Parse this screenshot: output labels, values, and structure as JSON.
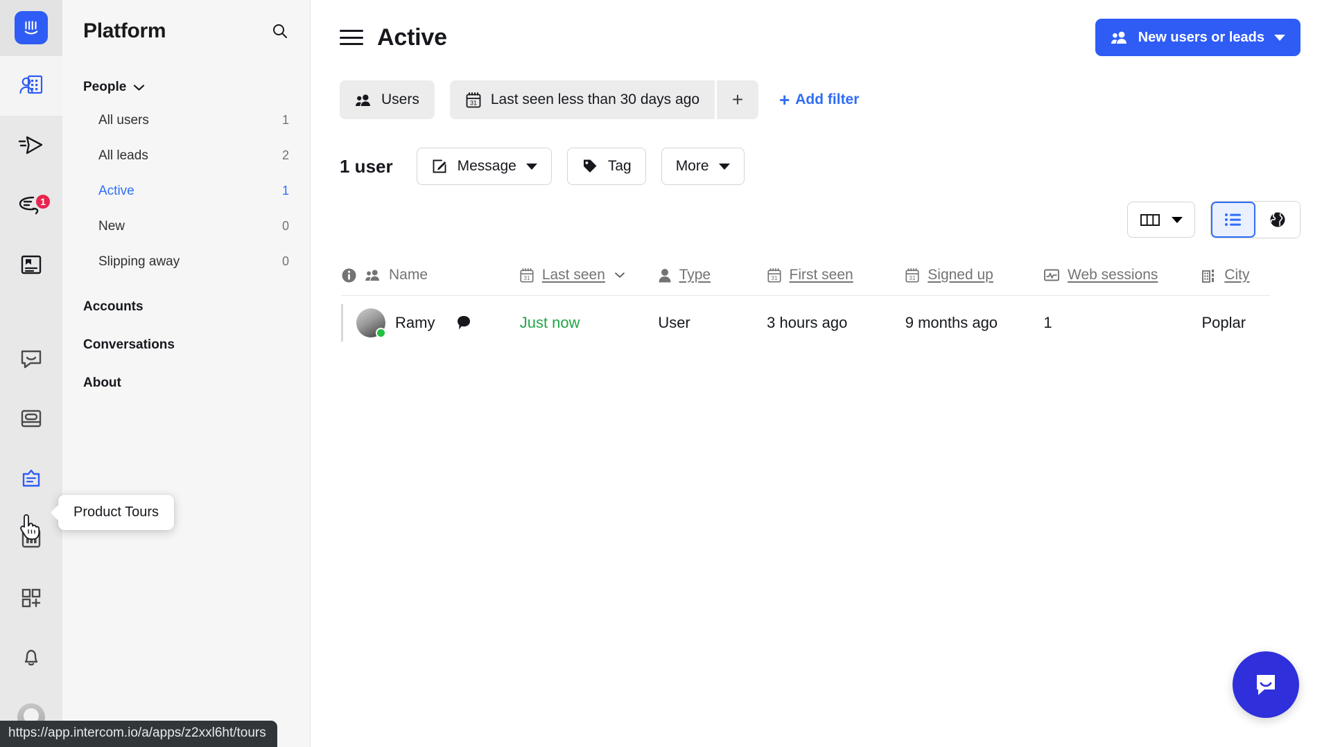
{
  "rail": {
    "logo_name": "intercom-logo",
    "items": [
      {
        "name": "contacts-icon",
        "badge": null,
        "active": true
      },
      {
        "name": "outbound-send-icon",
        "badge": null,
        "active": false
      },
      {
        "name": "conversations-reply-icon",
        "badge": "1",
        "active": false
      },
      {
        "name": "articles-icon",
        "badge": null,
        "active": false
      },
      {
        "name": "messenger-chat-icon",
        "badge": null,
        "active": false
      },
      {
        "name": "banners-icon",
        "badge": null,
        "active": false
      },
      {
        "name": "product-tours-icon",
        "badge": null,
        "active": false
      },
      {
        "name": "reports-chart-icon",
        "badge": null,
        "active": false
      },
      {
        "name": "app-store-icon",
        "badge": null,
        "active": false
      },
      {
        "name": "notifications-bell-icon",
        "badge": null,
        "active": false
      }
    ],
    "tooltip": "Product Tours"
  },
  "sidebar": {
    "title": "Platform",
    "search_icon": "search-icon",
    "group": {
      "label": "People",
      "chevron": "chevron-down-icon",
      "items": [
        {
          "label": "All users",
          "count": "1",
          "selected": false
        },
        {
          "label": "All leads",
          "count": "2",
          "selected": false
        },
        {
          "label": "Active",
          "count": "1",
          "selected": true
        },
        {
          "label": "New",
          "count": "0",
          "selected": false
        },
        {
          "label": "Slipping away",
          "count": "0",
          "selected": false
        }
      ]
    },
    "top_links": [
      "Accounts",
      "Conversations",
      "About"
    ]
  },
  "header": {
    "menu_icon": "hamburger-menu-icon",
    "title": "Active",
    "primary_button": {
      "label": "New users or leads",
      "icon": "users-icon",
      "caret": "chevron-down-icon",
      "color": "#2f5cf5"
    }
  },
  "filters": {
    "audience_chip": {
      "label": "Users",
      "icon": "users-icon"
    },
    "filter_chip": {
      "label": "Last seen less than 30 days ago",
      "icon": "calendar-icon"
    },
    "chip_plus": "+",
    "add_filter": "Add filter",
    "add_filter_plus": "+"
  },
  "actions": {
    "count_label": "1 user",
    "buttons": [
      {
        "label": "Message",
        "icon": "compose-icon",
        "caret": true
      },
      {
        "label": "Tag",
        "icon": "tag-icon",
        "caret": false
      },
      {
        "label": "More",
        "icon": null,
        "caret": true
      }
    ]
  },
  "view_controls": {
    "columns_button": {
      "icon": "columns-icon",
      "caret": "chevron-down-icon"
    },
    "list_view": {
      "icon": "list-view-icon",
      "active": true
    },
    "map_view": {
      "icon": "globe-icon",
      "active": false
    },
    "accent": "#2f6df6"
  },
  "table": {
    "columns": [
      {
        "key": "name",
        "label": "Name",
        "icon": "users-icon",
        "sortable": false,
        "info_icon": "info-icon"
      },
      {
        "key": "chat",
        "label": "",
        "icon": null,
        "sortable": false
      },
      {
        "key": "last_seen",
        "label": "Last seen",
        "icon": "calendar-icon",
        "sortable": true,
        "sorted": true,
        "sort_caret": "chevron-down-icon"
      },
      {
        "key": "type",
        "label": "Type",
        "icon": "person-icon",
        "sortable": true
      },
      {
        "key": "first_seen",
        "label": "First seen",
        "icon": "calendar-icon",
        "sortable": true
      },
      {
        "key": "signed_up",
        "label": "Signed up",
        "icon": "calendar-icon",
        "sortable": true
      },
      {
        "key": "web_sessions",
        "label": "Web sessions",
        "icon": "sessions-chart-icon",
        "sortable": true
      },
      {
        "key": "city",
        "label": "City",
        "icon": "company-building-icon",
        "sortable": true
      }
    ],
    "rows": [
      {
        "name": "Ramy",
        "avatar": "user-avatar",
        "online": true,
        "chat_icon": "chat-bubble-icon",
        "last_seen": "Just now",
        "last_seen_color": "#22a447",
        "type": "User",
        "first_seen": "3 hours ago",
        "signed_up": "9 months ago",
        "web_sessions": "1",
        "city": "Poplar"
      }
    ]
  },
  "messenger": {
    "icon": "intercom-messenger-icon",
    "color": "#2f2fdb"
  },
  "status_url": "https://app.intercom.io/a/apps/z2xxl6ht/tours"
}
